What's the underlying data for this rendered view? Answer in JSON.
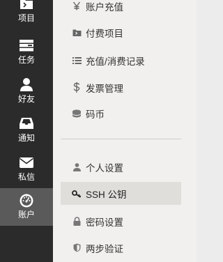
{
  "rail": {
    "items": [
      {
        "label": "项目",
        "icon": "folder-icon",
        "active": false
      },
      {
        "label": "任务",
        "icon": "tasks-icon",
        "active": false
      },
      {
        "label": "好友",
        "icon": "user-icon",
        "active": false
      },
      {
        "label": "通知",
        "icon": "inbox-icon",
        "active": false
      },
      {
        "label": "私信",
        "icon": "envelope-icon",
        "active": false
      },
      {
        "label": "账户",
        "icon": "dashboard-icon",
        "active": true
      }
    ]
  },
  "menu": {
    "account_group": [
      {
        "label": "账户充值",
        "icon": "yen-icon"
      },
      {
        "label": "付费项目",
        "icon": "folder-icon"
      },
      {
        "label": "充值/消费记录",
        "icon": "list-icon"
      },
      {
        "label": "发票管理",
        "icon": "dollar-icon"
      },
      {
        "label": "码币",
        "icon": "coins-icon"
      }
    ],
    "settings_group": [
      {
        "label": "个人设置",
        "icon": "user-icon",
        "active": false
      },
      {
        "label": "SSH 公钥",
        "icon": "key-icon",
        "active": true
      },
      {
        "label": "密码设置",
        "icon": "lock-icon",
        "active": false
      },
      {
        "label": "两步验证",
        "icon": "shield-icon",
        "active": false
      }
    ]
  },
  "colors": {
    "rail_bg": "#2b2b2b",
    "rail_active_bg": "#5a5a5a",
    "panel_bg": "#f1f0ee",
    "menu_active_bg": "#dfdedb",
    "icon_gray": "#666666"
  }
}
